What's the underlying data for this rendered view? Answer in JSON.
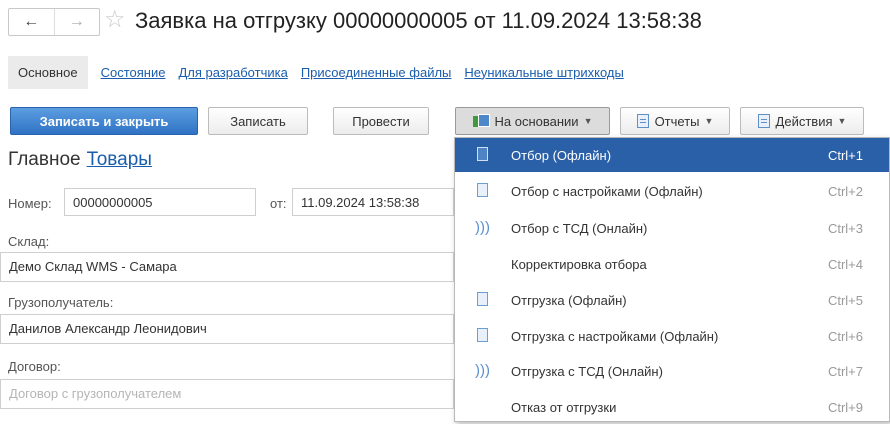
{
  "nav": {
    "back": "←",
    "forward": "→",
    "star": "☆"
  },
  "window": {
    "title": "Заявка на отгрузку 00000000005 от 11.09.2024 13:58:38"
  },
  "tabs": {
    "active": "Основное",
    "links": [
      "Состояние",
      "Для разработчика",
      "Присоединенные файлы",
      "Неуникальные штрихкоды"
    ]
  },
  "toolbar": {
    "save_close": "Записать и закрыть",
    "save": "Записать",
    "post": "Провести",
    "based_on": "На основании",
    "reports": "Отчеты",
    "actions": "Действия"
  },
  "form": {
    "section": "Главное",
    "section_link": "Товары",
    "number_label": "Номер:",
    "number_value": "00000000005",
    "date_label": "от:",
    "date_value": "11.09.2024 13:58:38",
    "warehouse_label": "Склад:",
    "warehouse_value": "Демо Склад WMS - Самара",
    "consignee_label": "Грузополучатель:",
    "consignee_value": "Данилов Александр Леонидович",
    "contract_label": "Договор:",
    "contract_placeholder": "Договор с грузополучателем"
  },
  "menu": {
    "items": [
      {
        "label": "Отбор (Офлайн)",
        "shortcut": "Ctrl+1",
        "icon": "document-icon",
        "selected": true
      },
      {
        "label": "Отбор с настройками (Офлайн)",
        "shortcut": "Ctrl+2",
        "icon": "document-icon"
      },
      {
        "label": "Отбор с ТСД (Онлайн)",
        "shortcut": "Ctrl+3",
        "icon": "wireless-icon"
      },
      {
        "label": "Корректировка отбора",
        "shortcut": "Ctrl+4",
        "icon": ""
      },
      {
        "label": "Отгрузка (Офлайн)",
        "shortcut": "Ctrl+5",
        "icon": "document-icon"
      },
      {
        "label": "Отгрузка с настройками (Офлайн)",
        "shortcut": "Ctrl+6",
        "icon": "document-icon"
      },
      {
        "label": "Отгрузка с ТСД (Онлайн)",
        "shortcut": "Ctrl+7",
        "icon": "wireless-icon"
      },
      {
        "label": "Отказ от отгрузки",
        "shortcut": "Ctrl+9",
        "icon": ""
      }
    ]
  },
  "colors": {
    "primary": "#2f72c4",
    "link": "#1a5dac",
    "selected": "#2a60a8"
  }
}
